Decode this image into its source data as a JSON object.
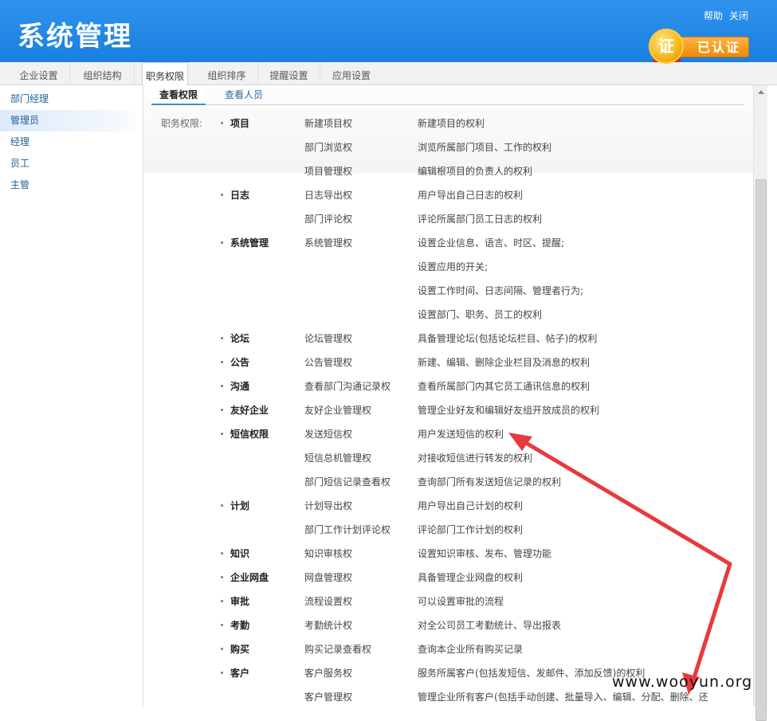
{
  "header": {
    "title": "系统管理",
    "help_link": "帮助",
    "close_link": "关闭",
    "badge_char": "证",
    "badge_text": "已认证"
  },
  "tabs": [
    {
      "label": "企业设置"
    },
    {
      "label": "组织结构"
    },
    {
      "label": "职务权限",
      "active": true
    },
    {
      "label": "组织排序"
    },
    {
      "label": "提醒设置"
    },
    {
      "label": "应用设置"
    }
  ],
  "sidebar": {
    "items": [
      {
        "label": "部门经理"
      },
      {
        "label": "管理员",
        "active": true
      },
      {
        "label": "经理"
      },
      {
        "label": "员工"
      },
      {
        "label": "主管"
      }
    ]
  },
  "subtabs": [
    {
      "label": "查看权限",
      "active": true
    },
    {
      "label": "查看人员"
    }
  ],
  "permissions_label": "职务权限:",
  "rows": [
    {
      "module": "项目",
      "perm": "新建项目权",
      "desc": "新建项目的权利"
    },
    {
      "module": "",
      "perm": "部门浏览权",
      "desc": "浏览所属部门项目、工作的权利"
    },
    {
      "module": "",
      "perm": "项目管理权",
      "desc": "编辑根项目的负责人的权利"
    },
    {
      "module": "日志",
      "perm": "日志导出权",
      "desc": "用户导出自己日志的权利"
    },
    {
      "module": "",
      "perm": "部门评论权",
      "desc": "评论所属部门员工日志的权利"
    },
    {
      "module": "系统管理",
      "perm": "系统管理权",
      "desc": "设置企业信息、语言、时区、提醒;"
    },
    {
      "module": "",
      "perm": "",
      "desc": "设置应用的开关;"
    },
    {
      "module": "",
      "perm": "",
      "desc": "设置工作时间、日志间隔、管理者行为;"
    },
    {
      "module": "",
      "perm": "",
      "desc": "设置部门、职务、员工的权利"
    },
    {
      "module": "论坛",
      "perm": "论坛管理权",
      "desc": "具备管理论坛(包括论坛栏目、帖子)的权利"
    },
    {
      "module": "公告",
      "perm": "公告管理权",
      "desc": "新建、编辑、删除企业栏目及消息的权利"
    },
    {
      "module": "沟通",
      "perm": "查看部门沟通记录权",
      "desc": "查看所属部门内其它员工通讯信息的权利"
    },
    {
      "module": "友好企业",
      "perm": "友好企业管理权",
      "desc": "管理企业好友和编辑好友组开放成员的权利"
    },
    {
      "module": "短信权限",
      "perm": "发送短信权",
      "desc": "用户发送短信的权利"
    },
    {
      "module": "",
      "perm": "短信总机管理权",
      "desc": "对接收短信进行转发的权利"
    },
    {
      "module": "",
      "perm": "部门短信记录查看权",
      "desc": "查询部门所有发送短信记录的权利"
    },
    {
      "module": "计划",
      "perm": "计划导出权",
      "desc": "用户导出自己计划的权利"
    },
    {
      "module": "",
      "perm": "部门工作计划评论权",
      "desc": "评论部门工作计划的权利"
    },
    {
      "module": "知识",
      "perm": "知识审核权",
      "desc": "设置知识审核、发布、管理功能"
    },
    {
      "module": "企业网盘",
      "perm": "网盘管理权",
      "desc": "具备管理企业网盘的权利"
    },
    {
      "module": "审批",
      "perm": "流程设置权",
      "desc": "可以设置审批的流程"
    },
    {
      "module": "考勤",
      "perm": "考勤统计权",
      "desc": "对全公司员工考勤统计、导出报表"
    },
    {
      "module": "购买",
      "perm": "购买记录查看权",
      "desc": "查询本企业所有购买记录"
    },
    {
      "module": "客户",
      "perm": "客户服务权",
      "desc": "服务所属客户(包括发短信、发邮件、添加反馈)的权利"
    },
    {
      "module": "",
      "perm": "客户管理权",
      "desc": "管理企业所有客户(包括手动创建、批量导入、编辑、分配、删除、还"
    }
  ],
  "watermark": "www.wooyun.org",
  "colors": {
    "header_blue": "#1a7fde",
    "link_blue": "#1f5f9a",
    "annotation_red": "#e8393c"
  }
}
